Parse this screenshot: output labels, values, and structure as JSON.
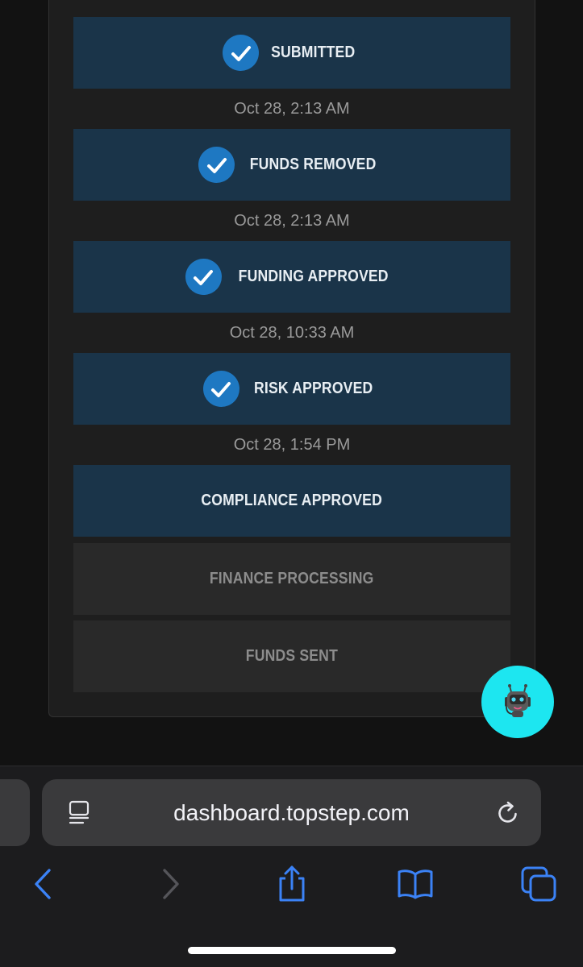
{
  "steps": [
    {
      "label": "SUBMITTED",
      "status": "done",
      "timestamp": "Oct 28, 2:13 AM"
    },
    {
      "label": "FUNDS REMOVED",
      "status": "done",
      "timestamp": "Oct 28, 2:13 AM"
    },
    {
      "label": "FUNDING APPROVED",
      "status": "done",
      "timestamp": "Oct 28, 10:33 AM"
    },
    {
      "label": "RISK APPROVED",
      "status": "done",
      "timestamp": "Oct 28, 1:54 PM"
    },
    {
      "label": "COMPLIANCE APPROVED",
      "status": "current"
    },
    {
      "label": "FINANCE PROCESSING",
      "status": "pending"
    },
    {
      "label": "FUNDS SENT",
      "status": "pending"
    }
  ],
  "chat_button": {
    "icon": "robot-icon",
    "color": "#1de6f0"
  },
  "browser": {
    "url": "dashboard.topstep.com",
    "accent": "#3b82f6",
    "icons": [
      "reader-mode-icon",
      "reload-icon",
      "back-icon",
      "forward-icon",
      "share-icon",
      "bookmarks-icon",
      "tabs-icon"
    ]
  }
}
